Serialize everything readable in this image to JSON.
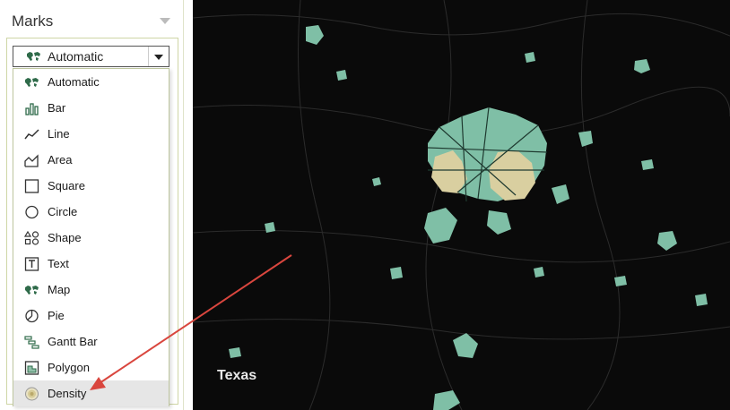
{
  "marks_panel": {
    "title": "Marks",
    "selected_value": "Automatic",
    "selected_icon": "map-icon",
    "options": [
      {
        "label": "Automatic",
        "icon": "map-icon"
      },
      {
        "label": "Bar",
        "icon": "bar-icon"
      },
      {
        "label": "Line",
        "icon": "line-icon"
      },
      {
        "label": "Area",
        "icon": "area-icon"
      },
      {
        "label": "Square",
        "icon": "square-icon"
      },
      {
        "label": "Circle",
        "icon": "circle-icon"
      },
      {
        "label": "Shape",
        "icon": "shape-icon"
      },
      {
        "label": "Text",
        "icon": "text-icon"
      },
      {
        "label": "Map",
        "icon": "map-icon"
      },
      {
        "label": "Pie",
        "icon": "pie-icon"
      },
      {
        "label": "Gantt Bar",
        "icon": "gantt-bar-icon"
      },
      {
        "label": "Polygon",
        "icon": "polygon-icon"
      },
      {
        "label": "Density",
        "icon": "density-icon",
        "highlighted": true
      }
    ]
  },
  "map": {
    "region_label": "Texas",
    "background_color": "#0a0a0a",
    "feature_color": "#7fbfa6",
    "highlight_color": "#d9cfa0"
  },
  "annotation": {
    "arrow_color": "#d9463e"
  }
}
